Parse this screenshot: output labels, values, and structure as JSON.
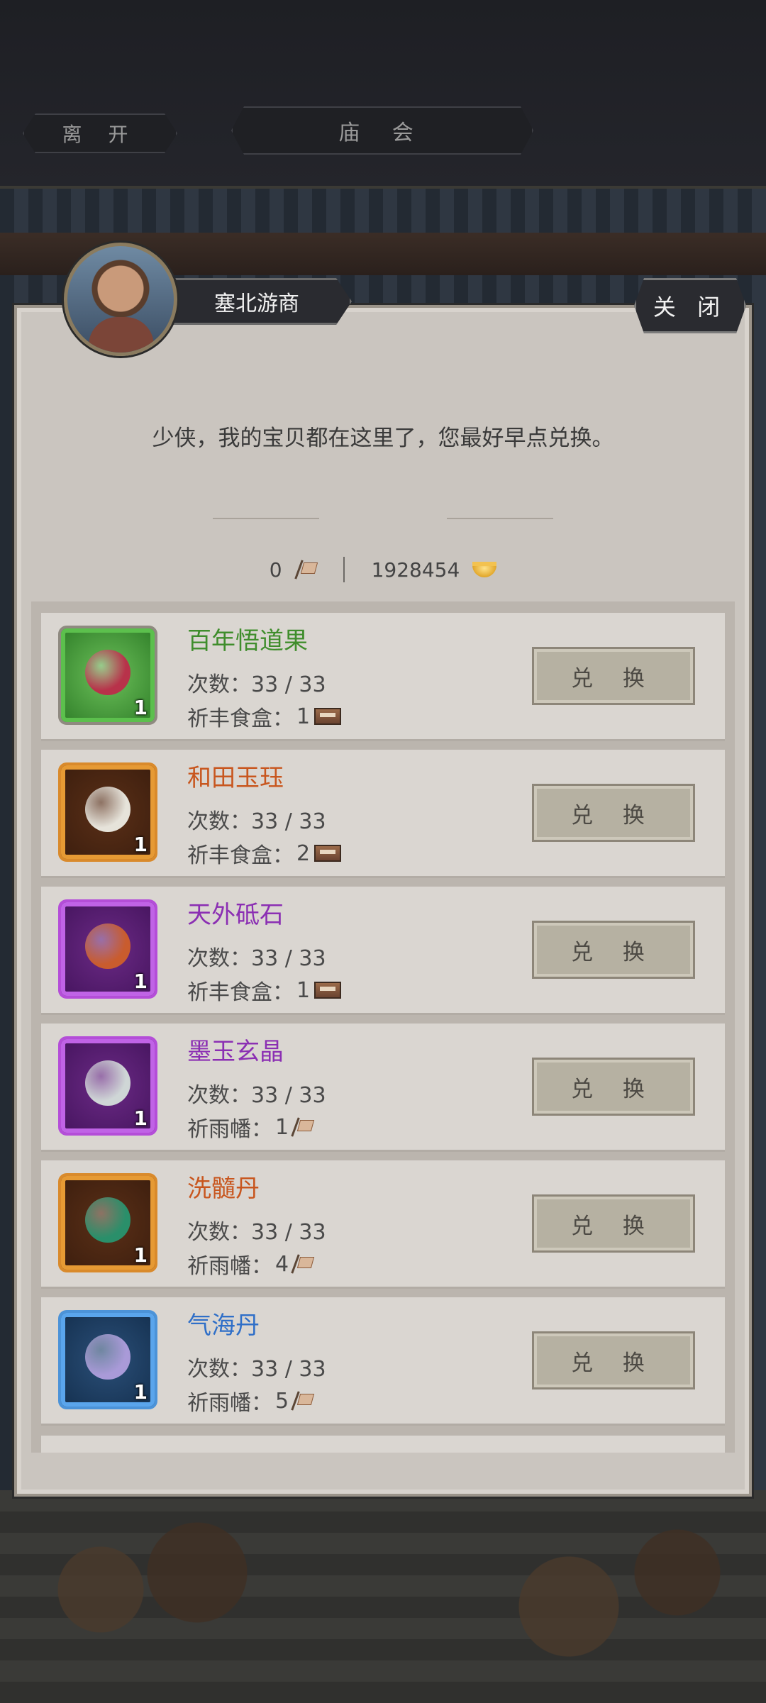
{
  "topbar": {
    "leave_label": "离 开",
    "title_label": "庙 会"
  },
  "merchant": {
    "name": "塞北游商"
  },
  "close_label": "关 闭",
  "greeting": "少侠，我的宝贝都在这里了，您最好早点兑换。",
  "currency": {
    "flags": "0",
    "gold": "1928454"
  },
  "exchange_label": "兑 换",
  "items": [
    {
      "name": "百年悟道果",
      "rarity": "green",
      "count": "1",
      "times": "次数：33 / 33",
      "cost_label": "祈丰食盒：",
      "cost_value": "1",
      "cost_icon": "food-box-icon",
      "art_color": "#b8324a"
    },
    {
      "name": "和田玉珏",
      "rarity": "orange",
      "count": "1",
      "times": "次数：33 / 33",
      "cost_label": "祈丰食盒：",
      "cost_value": "2",
      "cost_icon": "food-box-icon",
      "art_color": "#e6e3da"
    },
    {
      "name": "天外砥石",
      "rarity": "purple",
      "count": "1",
      "times": "次数：33 / 33",
      "cost_label": "祈丰食盒：",
      "cost_value": "1",
      "cost_icon": "food-box-icon",
      "art_color": "#c95c2e"
    },
    {
      "name": "墨玉玄晶",
      "rarity": "purple",
      "count": "1",
      "times": "次数：33 / 33",
      "cost_label": "祈雨幡：",
      "cost_value": "1",
      "cost_icon": "rain-flag-icon",
      "art_color": "#cfd6d6"
    },
    {
      "name": "洗髓丹",
      "rarity": "orange",
      "count": "1",
      "times": "次数：33 / 33",
      "cost_label": "祈雨幡：",
      "cost_value": "4",
      "cost_icon": "rain-flag-icon",
      "art_color": "#2a8f6a"
    },
    {
      "name": "气海丹",
      "rarity": "blue",
      "count": "1",
      "times": "次数：33 / 33",
      "cost_label": "祈雨幡：",
      "cost_value": "5",
      "cost_icon": "rain-flag-icon",
      "art_color": "#a99ad8"
    }
  ]
}
